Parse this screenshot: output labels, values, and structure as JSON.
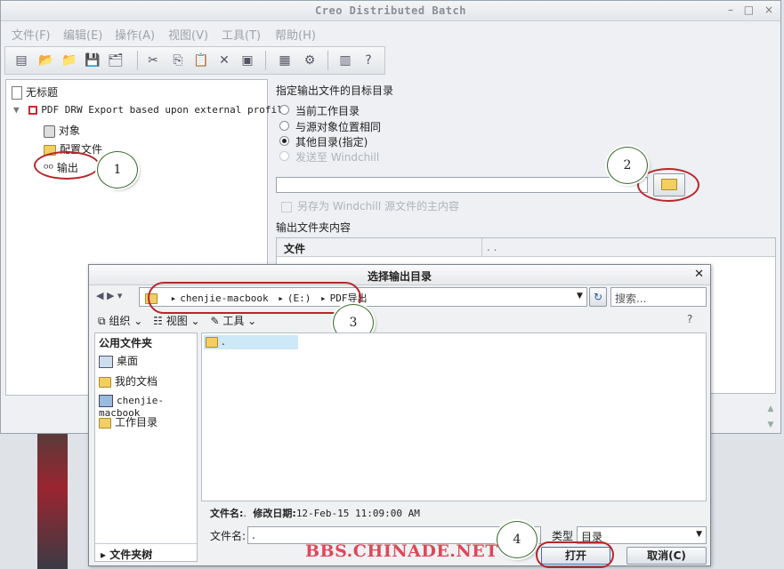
{
  "window": {
    "title": "Creo Distributed Batch",
    "controls": [
      "–",
      "□",
      "×"
    ]
  },
  "menu": [
    "文件(F)",
    "编辑(E)",
    "操作(A)",
    "视图(V)",
    "工具(T)",
    "帮助(H)"
  ],
  "toolbar_icons": [
    "list-icon",
    "open-icon",
    "folder-icon",
    "save-icon",
    "save-all-icon",
    "cut-icon",
    "copy-icon",
    "paste-icon",
    "delete-icon",
    "properties-icon",
    "document-icon",
    "settings-icon",
    "notes-icon",
    "help-icon"
  ],
  "tree": {
    "root": "无标题",
    "profile": "PDF DRW Export based upon external profile",
    "items": [
      "对象",
      "配置文件",
      "输出"
    ]
  },
  "output": {
    "heading": "指定输出文件的目标目录",
    "options": [
      "当前工作目录",
      "与源对象位置相同",
      "其他目录(指定)",
      "发送至 Windchill"
    ],
    "selected_index": 2,
    "checkbox_label": "另存为 Windchill 源文件的主内容",
    "folder_contents_label": "输出文件夹内容",
    "column_file": "文件",
    "column_dots": ". ."
  },
  "callouts": [
    "1",
    "2",
    "3",
    "4"
  ],
  "dialog": {
    "title": "选择输出目录",
    "path": [
      "chenjie-macbook",
      "(E:)",
      "PDF导出"
    ],
    "search_placeholder": "搜索...",
    "toolbar": {
      "organize": "组织",
      "views": "视图",
      "tools": "工具"
    },
    "places_header": "公用文件夹",
    "places": [
      "桌面",
      "我的文档",
      "chenjie-macbook",
      "工作目录"
    ],
    "folder_tree_label": "文件夹树",
    "file_entry": ".",
    "status_name_label": "文件名:",
    "status_name_value": ".",
    "status_date_label": "修改日期:",
    "status_date_value": "12-Feb-15 11:09:00 AM",
    "filename_label": "文件名:",
    "filename_value": ".",
    "type_label": "类型",
    "type_value": "目录",
    "open_button": "打开",
    "cancel_button": "取消(C)"
  },
  "watermark": "BBS.CHINADE.NET"
}
